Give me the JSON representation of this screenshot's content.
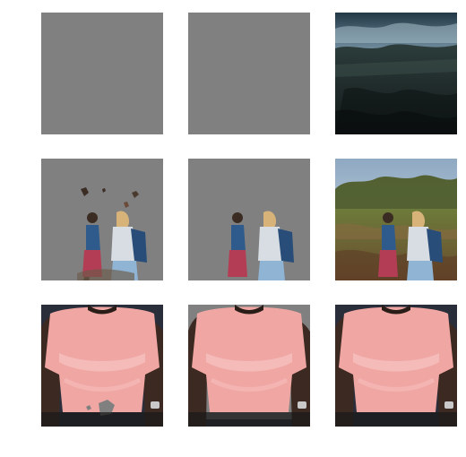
{
  "figure": {
    "rows": [
      {
        "cells": [
          {
            "kind": "empty-mask"
          },
          {
            "kind": "empty-mask"
          },
          {
            "kind": "landscape-dark"
          }
        ]
      },
      {
        "cells": [
          {
            "kind": "two-people-cutout-noisy"
          },
          {
            "kind": "two-people-cutout-clean"
          },
          {
            "kind": "two-people-landscape"
          }
        ]
      },
      {
        "cells": [
          {
            "kind": "pink-shirt-noisy"
          },
          {
            "kind": "pink-shirt-outline"
          },
          {
            "kind": "pink-shirt-photo"
          }
        ]
      }
    ],
    "colors": {
      "mask_gray": "#808080",
      "sky_blue": "#9fb4c8",
      "shirt_pink": "#f0a7a4",
      "skin_dark": "#3c2a22",
      "background_dark": "#2a2d3a"
    }
  }
}
